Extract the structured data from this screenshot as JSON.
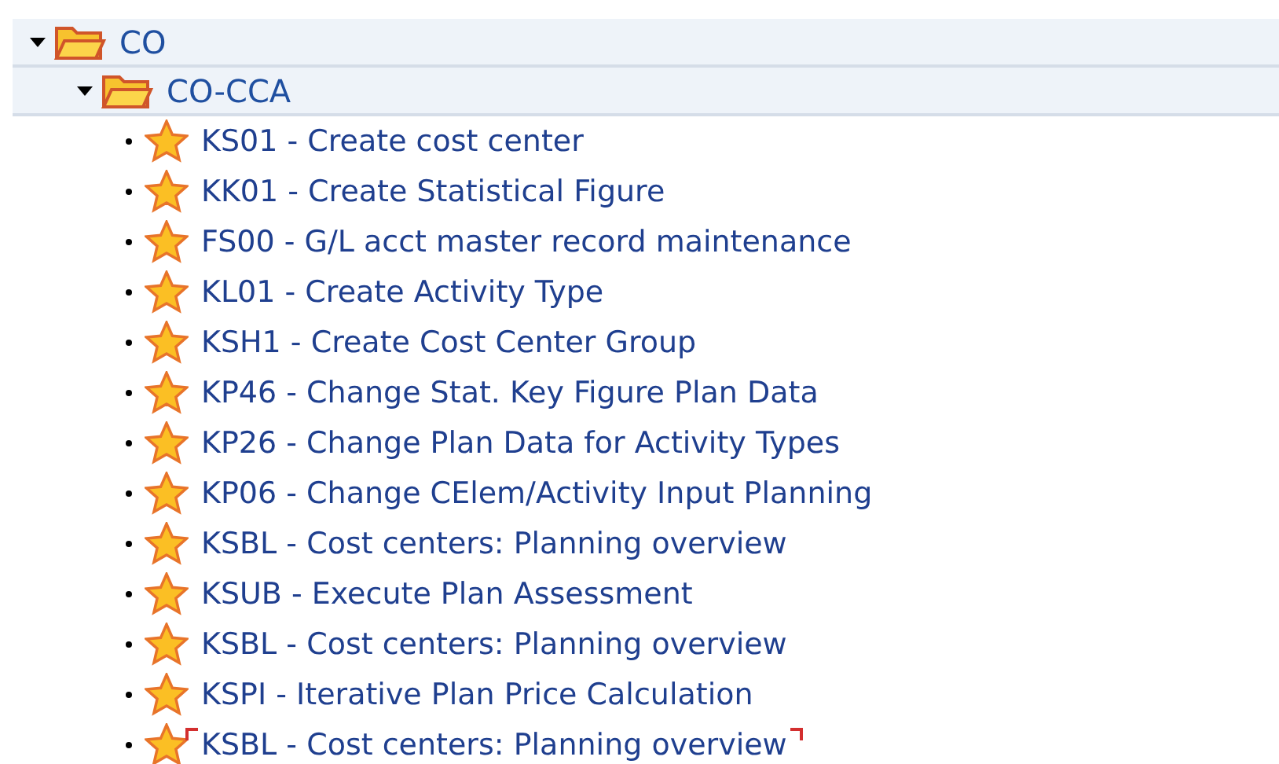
{
  "tree": [
    {
      "label": "CO",
      "expanded": true,
      "children": [
        {
          "label": "CO-CCA",
          "expanded": true,
          "children": [
            {
              "label": "KS01 - Create cost center",
              "selected": false
            },
            {
              "label": "KK01 - Create Statistical Figure",
              "selected": false
            },
            {
              "label": "FS00 - G/L acct master record maintenance",
              "selected": false
            },
            {
              "label": "KL01 - Create Activity Type",
              "selected": false
            },
            {
              "label": "KSH1 - Create Cost Center Group",
              "selected": false
            },
            {
              "label": "KP46 - Change Stat. Key Figure Plan Data",
              "selected": false
            },
            {
              "label": "KP26 - Change Plan Data for Activity Types",
              "selected": false
            },
            {
              "label": "KP06 - Change CElem/Activity Input Planning",
              "selected": false
            },
            {
              "label": "KSBL - Cost centers: Planning overview",
              "selected": false
            },
            {
              "label": "KSUB - Execute Plan Assessment",
              "selected": false
            },
            {
              "label": "KSBL - Cost centers: Planning overview",
              "selected": false
            },
            {
              "label": "KSPI - Iterative Plan Price Calculation",
              "selected": false
            },
            {
              "label": "KSBL - Cost centers: Planning overview",
              "selected": true
            }
          ]
        }
      ]
    }
  ]
}
